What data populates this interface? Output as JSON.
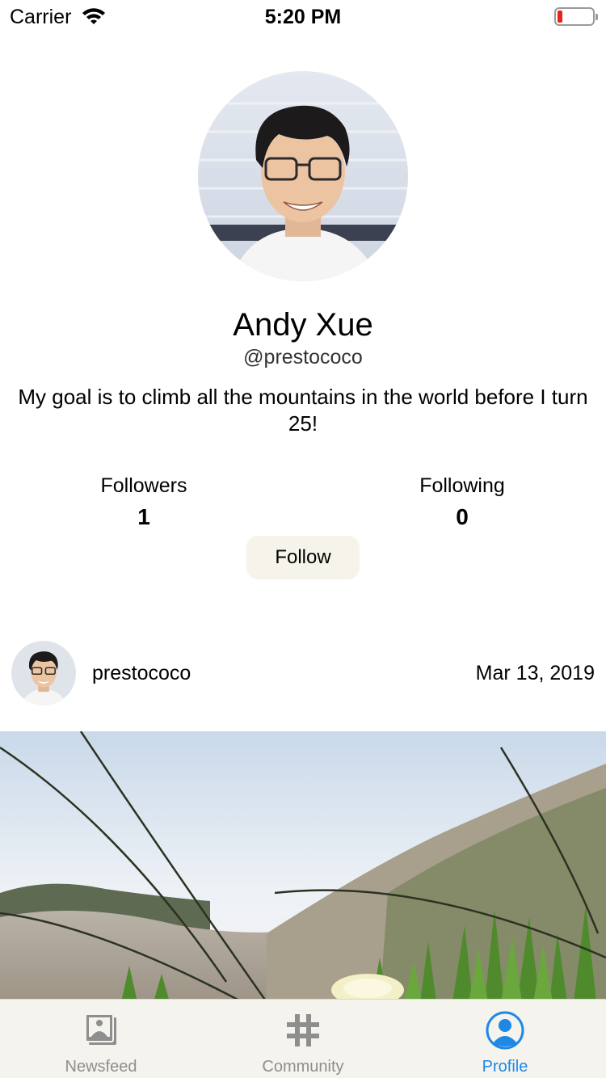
{
  "status_bar": {
    "carrier": "Carrier",
    "time": "5:20 PM",
    "battery_color": "#e8231b"
  },
  "profile": {
    "name": "Andy Xue",
    "handle": "@prestococo",
    "bio": "My goal is to climb all the mountains in the world before I turn 25!",
    "followers_label": "Followers",
    "followers_count": "1",
    "following_label": "Following",
    "following_count": "0",
    "follow_button_label": "Follow"
  },
  "post": {
    "username": "prestococo",
    "date": "Mar 13, 2019"
  },
  "tab_bar": {
    "tabs": [
      {
        "label": "Newsfeed",
        "icon": "photos-icon",
        "active": false
      },
      {
        "label": "Community",
        "icon": "hashtag-icon",
        "active": false
      },
      {
        "label": "Profile",
        "icon": "person-icon",
        "active": true
      }
    ]
  },
  "colors": {
    "accent": "#1e88e5",
    "inactive_tab": "#8e8e8e",
    "tab_bar_bg": "#f4f3ee",
    "follow_button_bg": "#f6f4ea"
  }
}
